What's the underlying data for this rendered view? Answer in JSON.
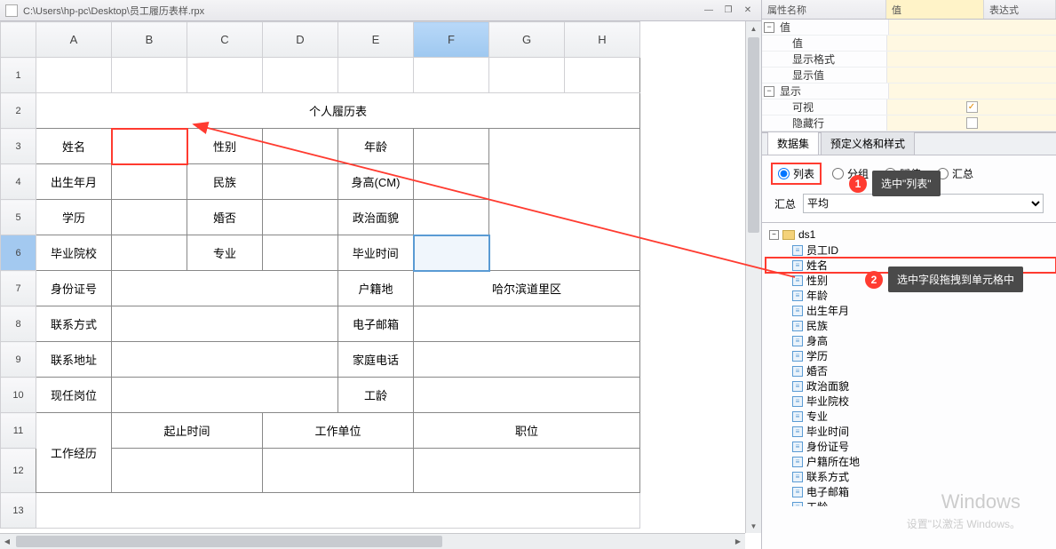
{
  "titlebar": {
    "path": "C:\\Users\\hp-pc\\Desktop\\员工履历表样.rpx"
  },
  "cols": [
    "A",
    "B",
    "C",
    "D",
    "E",
    "F",
    "G",
    "H"
  ],
  "rows": [
    "1",
    "2",
    "3",
    "4",
    "5",
    "6",
    "7",
    "8",
    "9",
    "10",
    "11",
    "12",
    "13"
  ],
  "form": {
    "title": "个人履历表",
    "r3": {
      "name": "姓名",
      "sex": "性别",
      "age": "年龄"
    },
    "r4": {
      "birth": "出生年月",
      "nation": "民族",
      "height": "身高(CM)"
    },
    "r5": {
      "edu": "学历",
      "marry": "婚否",
      "politic": "政治面貌"
    },
    "r6": {
      "school": "毕业院校",
      "major": "专业",
      "gradtime": "毕业时间"
    },
    "r7": {
      "idno": "身份证号",
      "hukou": "户籍地",
      "district": "哈尔滨道里区"
    },
    "r8": {
      "contact": "联系方式",
      "email": "电子邮箱"
    },
    "r9": {
      "addr": "联系地址",
      "phone": "家庭电话"
    },
    "r10": {
      "position": "现任岗位",
      "workage": "工龄"
    },
    "r11": {
      "period": "起止时间",
      "company": "工作单位",
      "job": "职位"
    },
    "r12": {
      "exp": "工作经历"
    }
  },
  "prop": {
    "headers": {
      "name": "属性名称",
      "value": "值",
      "expr": "表达式"
    },
    "nodes": {
      "val": "值",
      "val2": "值",
      "dispfmt": "显示格式",
      "dispval": "显示值",
      "disp": "显示",
      "visible": "可视",
      "hiderow": "隐藏行"
    }
  },
  "tabs": {
    "dataset": "数据集",
    "predef": "预定义格和样式"
  },
  "radios": {
    "list": "列表",
    "group": "分组",
    "assign": "赋值",
    "summary": "汇总"
  },
  "agg": {
    "label": "汇总",
    "value": "平均"
  },
  "ds": {
    "root": "ds1",
    "fields": [
      "员工ID",
      "姓名",
      "性别",
      "年龄",
      "出生年月",
      "民族",
      "身高",
      "学历",
      "婚否",
      "政治面貌",
      "毕业院校",
      "专业",
      "毕业时间",
      "身份证号",
      "户籍所在地",
      "联系方式",
      "电子邮箱",
      "工龄"
    ]
  },
  "callouts": {
    "c1": "选中\"列表\"",
    "c2": "选中字段拖拽到单元格中"
  },
  "watermark": {
    "main": "Windows",
    "sub": "设置\"以激活 Windows。"
  }
}
